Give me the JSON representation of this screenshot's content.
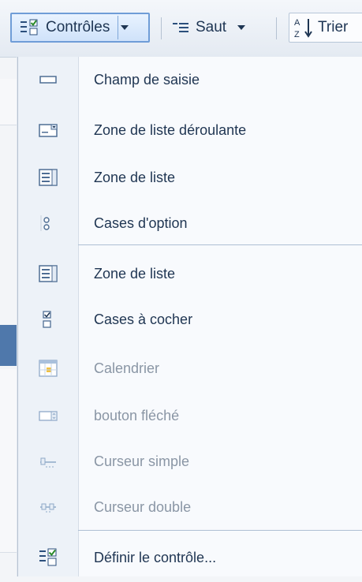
{
  "toolbar": {
    "controls_label": "Contrôles",
    "saut_label": "Saut",
    "trier_label": "Trier"
  },
  "menu": {
    "items": [
      {
        "label": "Champ de saisie",
        "icon": "text-field-icon",
        "enabled": true
      },
      {
        "label": "Zone de liste déroulante",
        "icon": "combo-box-icon",
        "enabled": true
      },
      {
        "label": "Zone de liste",
        "icon": "list-box-icon",
        "enabled": true
      },
      {
        "label": "Cases d'option",
        "icon": "radio-buttons-icon",
        "enabled": true
      },
      {
        "label": "Zone de liste",
        "icon": "list-box-icon",
        "enabled": true
      },
      {
        "label": "Cases à cocher",
        "icon": "checkboxes-icon",
        "enabled": true
      },
      {
        "label": "Calendrier",
        "icon": "calendar-icon",
        "enabled": false
      },
      {
        "label": "bouton fléché",
        "icon": "spin-button-icon",
        "enabled": false
      },
      {
        "label": "Curseur simple",
        "icon": "slider-icon",
        "enabled": false
      },
      {
        "label": "Curseur double",
        "icon": "double-slider-icon",
        "enabled": false
      },
      {
        "label": "Définir le contrôle...",
        "icon": "define-control-icon",
        "enabled": true
      }
    ]
  }
}
